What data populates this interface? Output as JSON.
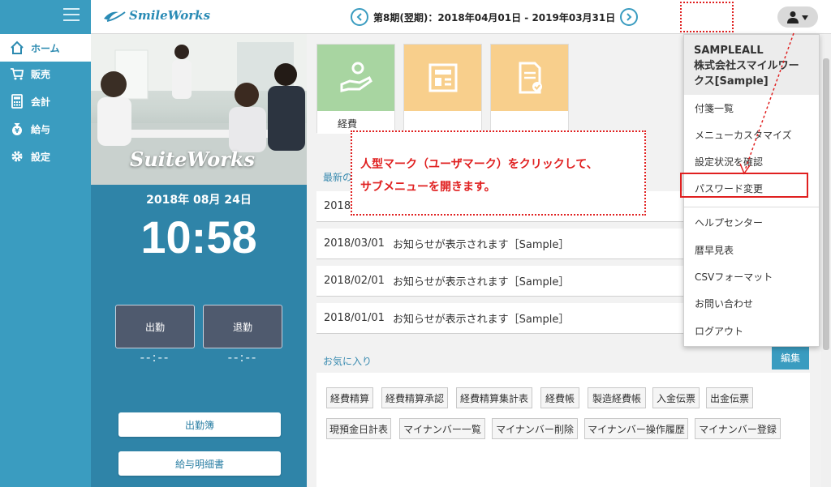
{
  "header": {
    "brand": "SmileWorks",
    "period_label": "第8期(翌期)：2018年04月01日 - 2019年03月31日"
  },
  "sidebar": {
    "items": [
      {
        "label": "ホーム",
        "icon": "home-icon"
      },
      {
        "label": "販売",
        "icon": "cart-icon"
      },
      {
        "label": "会計",
        "icon": "calculator-icon"
      },
      {
        "label": "給与",
        "icon": "money-bag-icon"
      },
      {
        "label": "設定",
        "icon": "gear-icon"
      }
    ]
  },
  "left_panel": {
    "photo_logo": "SuiteWorks",
    "date": "2018年 08月 24日",
    "time": "10:58",
    "clock_in_label": "出勤",
    "clock_out_label": "退勤",
    "clock_in_time": "--:--",
    "clock_out_time": "--:--",
    "attendance_button": "出勤簿",
    "payslip_button": "給与明細書"
  },
  "main": {
    "tiles": [
      {
        "label": "経費",
        "color": "#a8d5a1"
      },
      {
        "label": "",
        "color": "#f8cf8c"
      },
      {
        "label": "",
        "color": "#f8cf8c"
      }
    ],
    "news_title": "最新の",
    "news": [
      {
        "date": "2018",
        "text": ""
      },
      {
        "date": "2018/03/01",
        "text": "お知らせが表示されます［Sample］"
      },
      {
        "date": "2018/02/01",
        "text": "お知らせが表示されます［Sample］"
      },
      {
        "date": "2018/01/01",
        "text": "お知らせが表示されます［Sample］"
      }
    ],
    "favorites_title": "お気に入り",
    "edit_label": "編集",
    "favorites": [
      [
        "経費精算",
        "経費精算承認",
        "経費精算集計表",
        "経費帳",
        "製造経費帳",
        "入金伝票",
        "出金伝票"
      ],
      [
        "現預金日計表",
        "マイナンバー一覧",
        "マイナンバー削除",
        "マイナンバー操作履歴",
        "マイナンバー登録"
      ]
    ]
  },
  "dropdown": {
    "user_name": "SAMPLEALL",
    "company_line1": "株式会社スマイルワー",
    "company_line2": "クス[Sample]",
    "items": [
      "付箋一覧",
      "メニューカスタマイズ",
      "設定状況を確認",
      "パスワード変更",
      "ヘルプセンター",
      "暦早見表",
      "CSVフォーマット",
      "お問い合わせ",
      "ログアウト"
    ]
  },
  "annotation": {
    "line1": "人型マーク（ユーザマーク）をクリックして、",
    "line2": "サブメニューを開きます。"
  },
  "colors": {
    "accent": "#3a9cc0",
    "highlight": "#e02020"
  }
}
